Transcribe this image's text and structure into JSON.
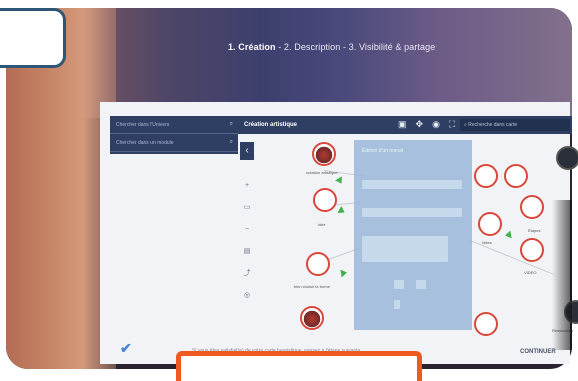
{
  "wizard": {
    "step1": "1. Création",
    "step2": " - 2. Description",
    "step3": " - 3. Visibilité & partage"
  },
  "left_panel": {
    "field1": "Chercher dans l'Univers",
    "field2": "Chercher dans un module"
  },
  "toolbar": {
    "title": "Création artistique",
    "search_placeholder": "Recherche dans carte",
    "icons": [
      "save-icon",
      "move-icon",
      "target-icon",
      "fullscreen-icon"
    ]
  },
  "nodes": {
    "n1": "création artistique",
    "n2": "idée",
    "n3": "bien choisir la forme",
    "n4": "Étapes",
    "n5": "Idées",
    "n6": "VIDEO",
    "n7": "Ressources"
  },
  "modal": {
    "title": "Édition d'un noeud"
  },
  "footer": {
    "hint": "Si vous êtes satisfait(e) de votre carte heuristique, passez à l'étape suivante",
    "continue_label": "CONTINUER"
  },
  "colors": {
    "accent_orange": "#ef5a1e",
    "toolbar_navy": "#2e3f63",
    "node_red": "#d8473a",
    "check_blue": "#4b86d6"
  }
}
